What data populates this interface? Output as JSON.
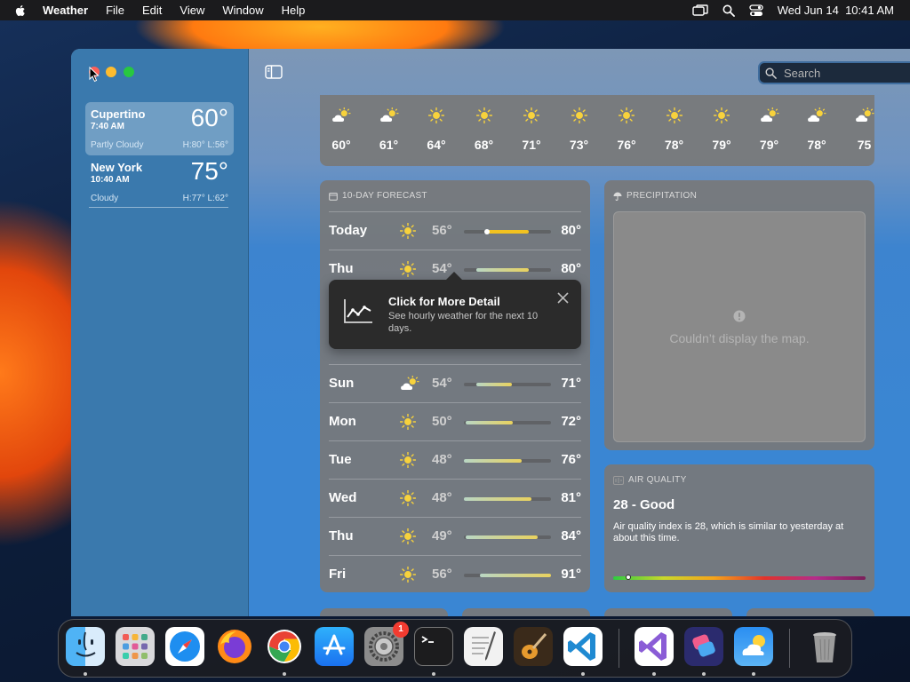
{
  "menubar": {
    "app_name": "Weather",
    "items": [
      "File",
      "Edit",
      "View",
      "Window",
      "Help"
    ],
    "datetime": "Wed Jun 14  10:41 AM"
  },
  "sidebar": {
    "locations": [
      {
        "name": "Cupertino",
        "time": "7:40 AM",
        "temp": "60°",
        "condition": "Partly Cloudy",
        "hilo": "H:80°  L:56°",
        "selected": true
      },
      {
        "name": "New York",
        "time": "10:40 AM",
        "temp": "75°",
        "condition": "Cloudy",
        "hilo": "H:77°  L:62°",
        "selected": false
      }
    ]
  },
  "search": {
    "placeholder": "Search",
    "value": ""
  },
  "hourly": [
    {
      "icon": "partly-cloudy-icon",
      "temp": "60°"
    },
    {
      "icon": "partly-cloudy-icon",
      "temp": "61°"
    },
    {
      "icon": "sun-icon",
      "temp": "64°"
    },
    {
      "icon": "sun-icon",
      "temp": "68°"
    },
    {
      "icon": "sun-icon",
      "temp": "71°"
    },
    {
      "icon": "sun-icon",
      "temp": "73°"
    },
    {
      "icon": "sun-icon",
      "temp": "76°"
    },
    {
      "icon": "sun-icon",
      "temp": "78°"
    },
    {
      "icon": "sun-icon",
      "temp": "79°"
    },
    {
      "icon": "partly-cloudy-icon",
      "temp": "79°"
    },
    {
      "icon": "partly-cloudy-icon",
      "temp": "78°"
    },
    {
      "icon": "partly-cloudy-icon",
      "temp": "75"
    }
  ],
  "forecast": {
    "title": "10-DAY FORECAST",
    "rows": [
      {
        "day": "Today",
        "icon": "sun-icon",
        "low": "56°",
        "high": "80°",
        "range": [
          0.28,
          0.75
        ],
        "current": 0.27
      },
      {
        "day": "Thu",
        "icon": "sun-icon",
        "low": "54°",
        "high": "80°",
        "range": [
          0.14,
          0.75
        ]
      },
      {
        "day": "Sun",
        "icon": "partly-cloudy-icon",
        "low": "54°",
        "high": "71°",
        "range": [
          0.14,
          0.55
        ]
      },
      {
        "day": "Mon",
        "icon": "sun-icon",
        "low": "50°",
        "high": "72°",
        "range": [
          0.02,
          0.56
        ]
      },
      {
        "day": "Tue",
        "icon": "sun-icon",
        "low": "48°",
        "high": "76°",
        "range": [
          0.0,
          0.66
        ]
      },
      {
        "day": "Wed",
        "icon": "sun-icon",
        "low": "48°",
        "high": "81°",
        "range": [
          0.0,
          0.78
        ]
      },
      {
        "day": "Thu",
        "icon": "sun-icon",
        "low": "49°",
        "high": "84°",
        "range": [
          0.02,
          0.85
        ]
      },
      {
        "day": "Fri",
        "icon": "sun-icon",
        "low": "56°",
        "high": "91°",
        "range": [
          0.18,
          1.0
        ]
      }
    ]
  },
  "tooltip": {
    "title": "Click for More Detail",
    "body": "See hourly weather for the next 10 days."
  },
  "precipitation": {
    "title": "PRECIPITATION",
    "message": "Couldn’t display the map."
  },
  "air_quality": {
    "title": "AIR QUALITY",
    "value": "28 - Good",
    "description": "Air quality index is 28, which is similar to yesterday at about this time.",
    "position": 0.06
  },
  "dock": {
    "badge_settings": "1"
  }
}
